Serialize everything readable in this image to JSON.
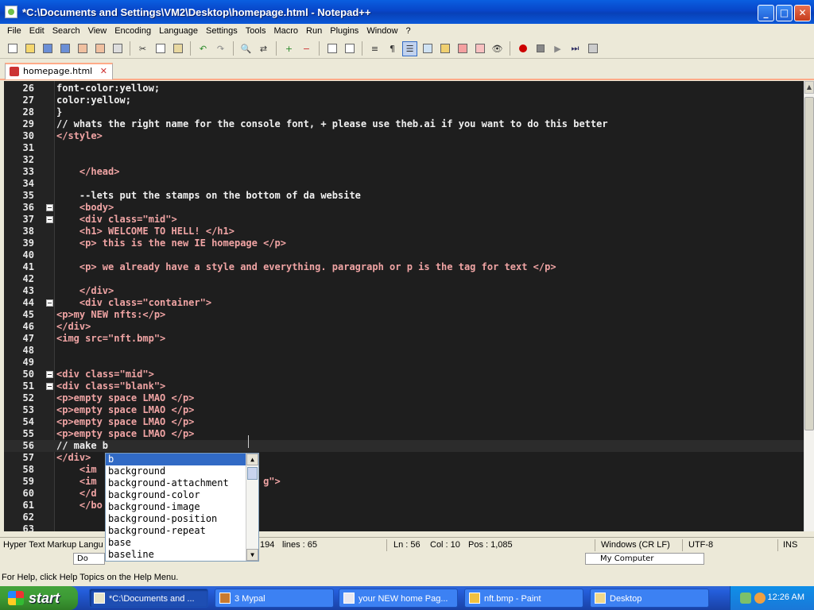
{
  "window": {
    "title": "*C:\\Documents and Settings\\VM2\\Desktop\\homepage.html - Notepad++"
  },
  "window_buttons": {
    "minimize": "_",
    "maximize": "□",
    "close": "✕"
  },
  "menu": [
    "File",
    "Edit",
    "Search",
    "View",
    "Encoding",
    "Language",
    "Settings",
    "Tools",
    "Macro",
    "Run",
    "Plugins",
    "Window",
    "?"
  ],
  "tab": {
    "label": "homepage.html",
    "close": "✕"
  },
  "editor": {
    "lines": [
      {
        "n": "26",
        "text": "font-color:yellow;",
        "fold": false
      },
      {
        "n": "27",
        "text": "color:yellow;",
        "fold": false
      },
      {
        "n": "28",
        "text": "}",
        "fold": false
      },
      {
        "n": "29",
        "text": "// whats the right name for the console font, + please use theb.ai if you want to do this better",
        "fold": false
      },
      {
        "n": "30",
        "text": "</style>",
        "fold": false
      },
      {
        "n": "31",
        "text": "",
        "fold": false
      },
      {
        "n": "32",
        "text": "",
        "fold": false
      },
      {
        "n": "33",
        "text": "    </head>",
        "fold": false
      },
      {
        "n": "34",
        "text": "",
        "fold": false
      },
      {
        "n": "35",
        "text": "    --lets put the stamps on the bottom of da website",
        "fold": false
      },
      {
        "n": "36",
        "text": "    <body>",
        "fold": true
      },
      {
        "n": "37",
        "text": "    <div class=\"mid\">",
        "fold": true
      },
      {
        "n": "38",
        "text": "    <h1> WELCOME TO HELL! </h1>",
        "fold": false
      },
      {
        "n": "39",
        "text": "    <p> this is the new IE homepage </p>",
        "fold": false
      },
      {
        "n": "40",
        "text": "",
        "fold": false
      },
      {
        "n": "41",
        "text": "    <p> we already have a style and everything. paragraph or p is the tag for text </p>",
        "fold": false
      },
      {
        "n": "42",
        "text": "",
        "fold": false
      },
      {
        "n": "43",
        "text": "    </div>",
        "fold": false
      },
      {
        "n": "44",
        "text": "    <div class=\"container\">",
        "fold": true
      },
      {
        "n": "45",
        "text": "<p>my NEW nfts:</p>",
        "fold": false
      },
      {
        "n": "46",
        "text": "</div>",
        "fold": false
      },
      {
        "n": "47",
        "text": "<img src=\"nft.bmp\">",
        "fold": false
      },
      {
        "n": "48",
        "text": "",
        "fold": false
      },
      {
        "n": "49",
        "text": "",
        "fold": false
      },
      {
        "n": "50",
        "text": "<div class=\"mid\">",
        "fold": true
      },
      {
        "n": "51",
        "text": "<div class=\"blank\">",
        "fold": true
      },
      {
        "n": "52",
        "text": "<p>empty space LMAO </p>",
        "fold": false
      },
      {
        "n": "53",
        "text": "<p>empty space LMAO </p>",
        "fold": false
      },
      {
        "n": "54",
        "text": "<p>empty space LMAO </p>",
        "fold": false
      },
      {
        "n": "55",
        "text": "<p>empty space LMAO </p>",
        "fold": false
      },
      {
        "n": "56",
        "text": "// make b",
        "fold": false,
        "current": true
      },
      {
        "n": "57",
        "text": "</div>",
        "fold": false
      },
      {
        "n": "58",
        "text": "    <im",
        "fold": false
      },
      {
        "n": "59",
        "text": "    <im                             g\">",
        "fold": false
      },
      {
        "n": "60",
        "text": "    </d",
        "fold": false
      },
      {
        "n": "61",
        "text": "    </bo",
        "fold": false
      },
      {
        "n": "62",
        "text": "",
        "fold": false
      },
      {
        "n": "63",
        "text": "",
        "fold": false
      }
    ]
  },
  "autocomplete": {
    "items": [
      "b",
      "background",
      "background-attachment",
      "background-color",
      "background-image",
      "background-position",
      "background-repeat",
      "base",
      "baseline"
    ],
    "selected": 0
  },
  "statusbar": {
    "language": "Hyper Text Markup Langu",
    "length": "194",
    "lines": "lines : 65",
    "ln": "Ln : 56",
    "col": "Col : 10",
    "pos": "Pos : 1,085",
    "eol": "Windows (CR LF)",
    "encoding": "UTF-8",
    "mode": "INS"
  },
  "under_strip": {
    "left": "Do",
    "right": "My Computer"
  },
  "helpbar": {
    "text": "For Help, click Help Topics on the Help Menu."
  },
  "taskbar": {
    "start": "start",
    "tasks": [
      {
        "label": "*C:\\Documents and ...",
        "active": true
      },
      {
        "label": "3 Mypal",
        "active": false
      },
      {
        "label": "your NEW home Pag...",
        "active": false
      },
      {
        "label": "nft.bmp - Paint",
        "active": false
      },
      {
        "label": "Desktop",
        "active": false
      }
    ],
    "time": "12:26 AM"
  }
}
